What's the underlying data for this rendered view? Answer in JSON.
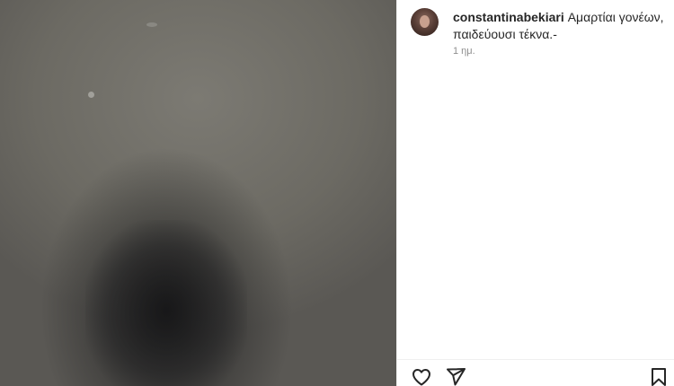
{
  "post": {
    "username": "constantinabekiari",
    "caption_text": "Αμαρτίαι γονέων, παιδεύουσι τέκνα.-",
    "time_ago": "1 ημ."
  },
  "actions": {
    "like_icon": "heart-icon",
    "share_icon": "paper-plane-icon",
    "save_icon": "bookmark-icon"
  }
}
